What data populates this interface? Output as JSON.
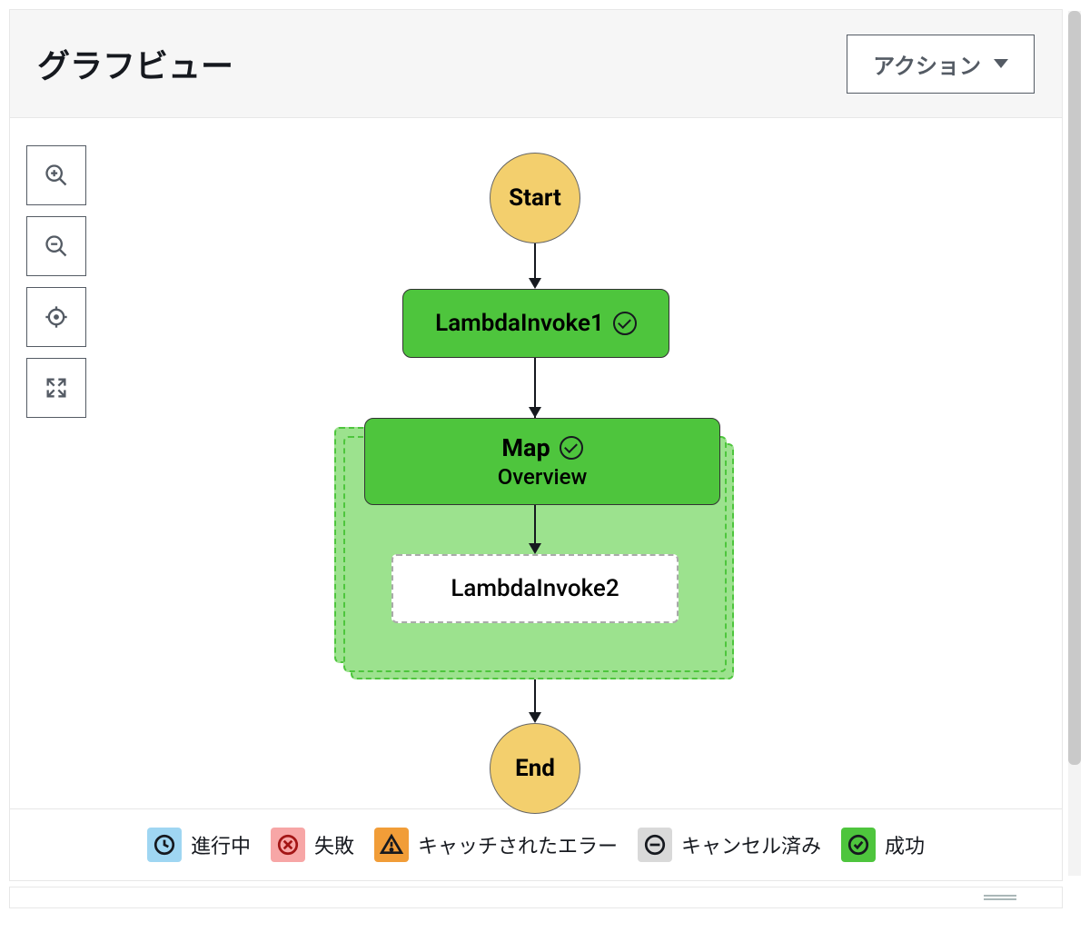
{
  "header": {
    "title": "グラフビュー",
    "action_label": "アクション"
  },
  "graph": {
    "start": "Start",
    "end": "End",
    "state1": "LambdaInvoke1",
    "map": {
      "title": "Map",
      "subtitle": "Overview"
    },
    "state2": "LambdaInvoke2"
  },
  "legend": {
    "inprogress": "進行中",
    "failed": "失敗",
    "caught": "キャッチされたエラー",
    "cancelled": "キャンセル済み",
    "success": "成功"
  }
}
